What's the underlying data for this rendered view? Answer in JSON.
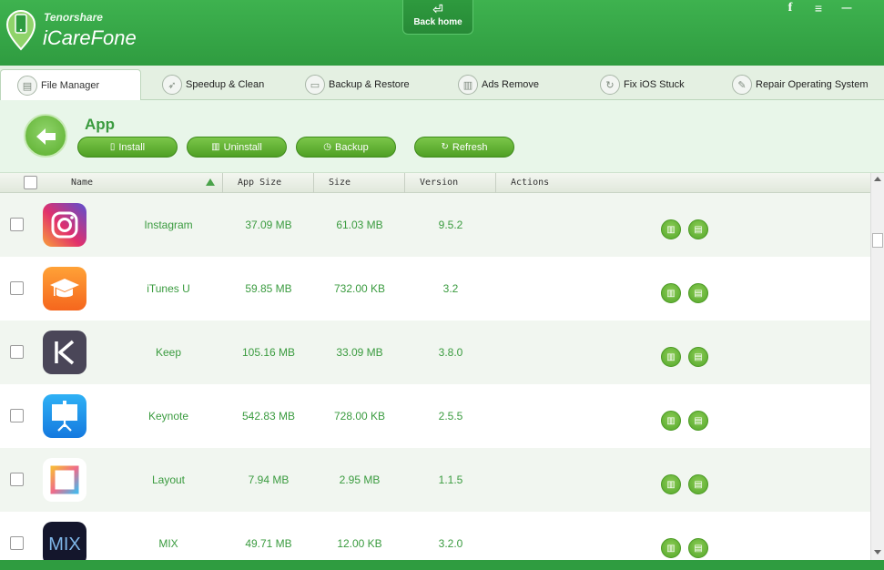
{
  "header": {
    "brand_small": "Tenorshare",
    "brand_big": "iCareFone",
    "back_home": "Back home",
    "icons": [
      "facebook-icon",
      "menu-icon",
      "minimize-icon",
      "close-icon"
    ],
    "facebook_glyph": "f",
    "menu_glyph": "≡",
    "minimize_glyph": "—",
    "close_glyph": "✕"
  },
  "tabs": [
    {
      "label": "File  Manager",
      "icon": "file-manager-icon",
      "active": true
    },
    {
      "label": "Speedup & Clean",
      "icon": "rocket-icon",
      "active": false
    },
    {
      "label": "Backup & Restore",
      "icon": "folder-icon",
      "active": false
    },
    {
      "label": "Ads Remove",
      "icon": "trash-icon",
      "active": false
    },
    {
      "label": "Fix iOS Stuck",
      "icon": "refresh-icon",
      "active": false
    },
    {
      "label": "Repair Operating System",
      "icon": "wrench-icon",
      "active": false
    }
  ],
  "appbar": {
    "title": "App",
    "install": "Install",
    "uninstall": "Uninstall",
    "backup": "Backup",
    "refresh": "Refresh"
  },
  "table": {
    "columns": [
      "Name",
      "App Size",
      "Size",
      "Version",
      "Actions"
    ],
    "rows": [
      {
        "name": "Instagram",
        "app_size": "37.09 MB",
        "size": "61.03 MB",
        "version": "9.5.2",
        "icon": "instagram-icon"
      },
      {
        "name": "iTunes U",
        "app_size": "59.85 MB",
        "size": "732.00 KB",
        "version": "3.2",
        "icon": "itunes-u-icon"
      },
      {
        "name": "Keep",
        "app_size": "105.16 MB",
        "size": "33.09 MB",
        "version": "3.8.0",
        "icon": "keep-icon"
      },
      {
        "name": "Keynote",
        "app_size": "542.83 MB",
        "size": "728.00 KB",
        "version": "2.5.5",
        "icon": "keynote-icon"
      },
      {
        "name": "Layout",
        "app_size": "7.94 MB",
        "size": "2.95 MB",
        "version": "1.1.5",
        "icon": "layout-icon"
      },
      {
        "name": "MIX",
        "app_size": "49.71 MB",
        "size": "12.00 KB",
        "version": "3.2.0",
        "icon": "mix-icon"
      }
    ]
  },
  "icons": {
    "mix_text": "MIX"
  },
  "colors": {
    "brand_green": "#2f9c40",
    "text_green": "#3a9b3f",
    "button_green": "#5aa82c"
  }
}
